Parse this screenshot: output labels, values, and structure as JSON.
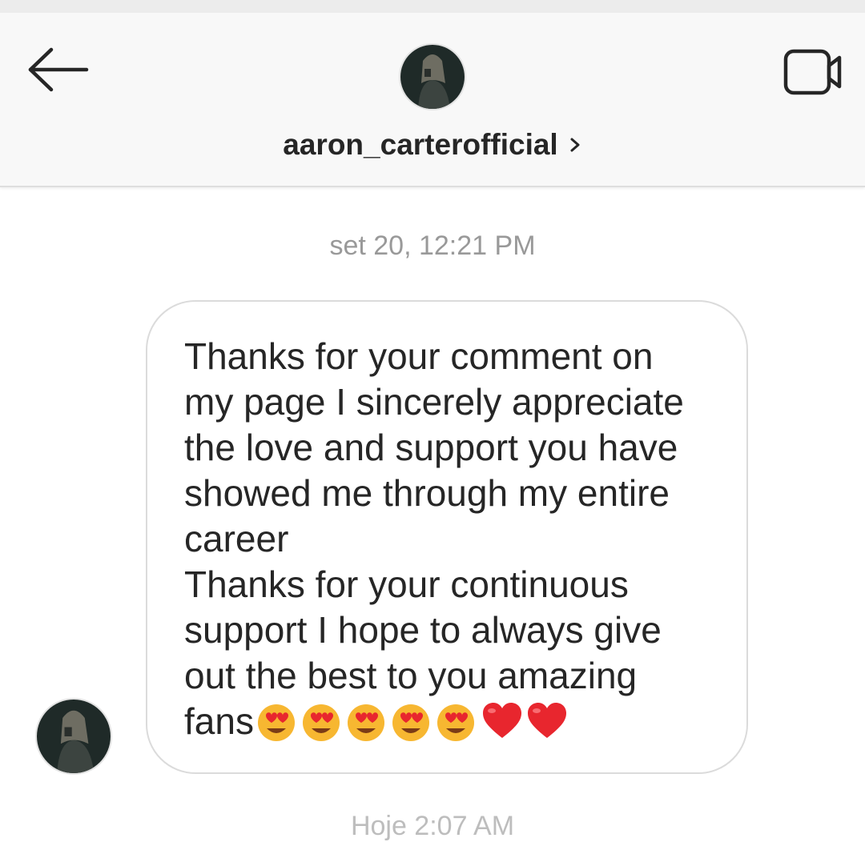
{
  "header": {
    "back_icon": "arrow-left-icon",
    "video_icon": "video-camera-icon",
    "username": "aaron_carterofficial",
    "chevron_icon": "chevron-right-icon"
  },
  "thread": {
    "timestamp": "set 20, 12:21 PM",
    "message": {
      "lines": [
        "Thanks for your comment on",
        "my page I sincerely appreciate",
        "the love and support you have",
        "showed me through my entire",
        "career",
        "Thanks for your continuous",
        "support I hope to always give",
        "out the best to you amazing",
        "fans"
      ],
      "emojis": [
        "heart-eyes-emoji",
        "heart-eyes-emoji",
        "heart-eyes-emoji",
        "heart-eyes-emoji",
        "heart-eyes-emoji",
        "red-heart-emoji",
        "red-heart-emoji"
      ]
    },
    "next_timestamp_partial": "Hoje 2:07 AM"
  },
  "colors": {
    "text": "#262626",
    "muted": "#999999",
    "bubble_border": "#dbdbdb",
    "header_bg": "#f8f8f8",
    "emoji_face": "#f7b731",
    "heart": "#e8262e"
  }
}
